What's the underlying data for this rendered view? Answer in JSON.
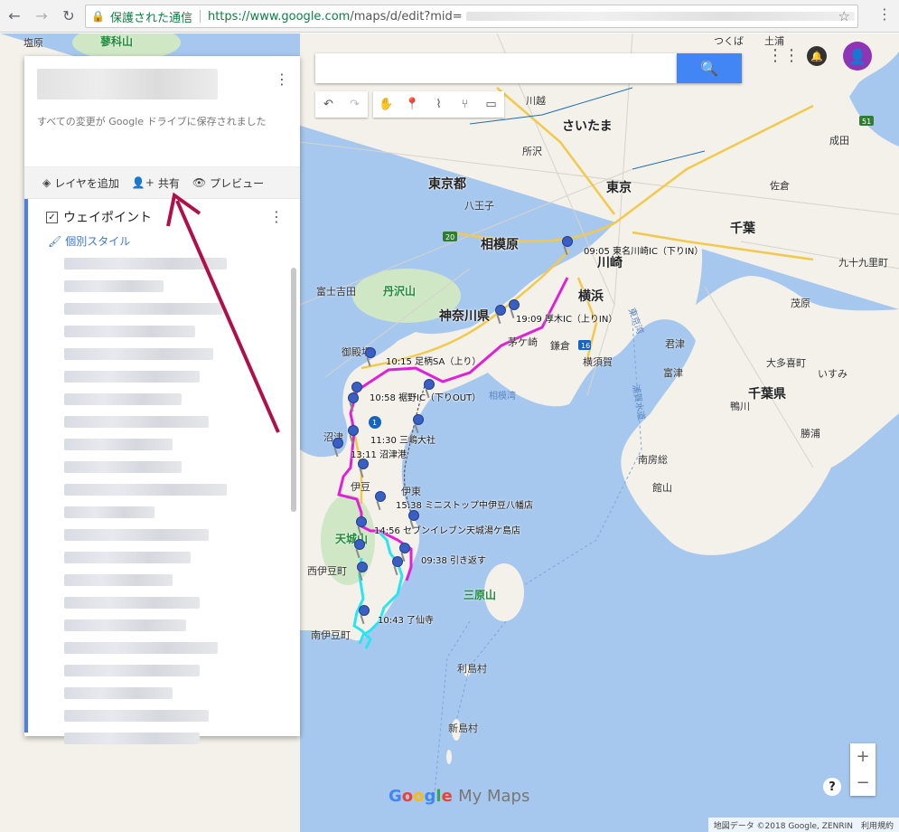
{
  "browser": {
    "secure_label": "保護された通信",
    "url_host": "https://www.google.com",
    "url_rest": "/maps/d/edit?mid="
  },
  "panel": {
    "saved_text": "すべての変更が Google ドライブに保存されました",
    "actions": {
      "add_layer": "レイヤを追加",
      "share": "共有",
      "preview": "プレビュー"
    },
    "layer": {
      "name": "ウェイポイント",
      "style_link": "個別スタイル"
    }
  },
  "search": {
    "placeholder": ""
  },
  "map_labels": {
    "cities": [
      {
        "id": "tokyo",
        "text": "東京都"
      },
      {
        "id": "saitama",
        "text": "さいたま"
      },
      {
        "id": "tokyo2",
        "text": "東京"
      },
      {
        "id": "sagamihara",
        "text": "相模原"
      },
      {
        "id": "kawasaki",
        "text": "川崎"
      },
      {
        "id": "yokohama",
        "text": "横浜"
      },
      {
        "id": "kanagawa",
        "text": "神奈川県"
      },
      {
        "id": "chiba",
        "text": "千葉"
      },
      {
        "id": "chibaken",
        "text": "千葉県"
      }
    ],
    "towns": [
      {
        "id": "shiobara",
        "text": "塩原"
      },
      {
        "id": "kawagoe",
        "text": "川越"
      },
      {
        "id": "tokorozawa",
        "text": "所沢"
      },
      {
        "id": "hachioji",
        "text": "八王子"
      },
      {
        "id": "kamakura",
        "text": "鎌倉"
      },
      {
        "id": "chigasaki",
        "text": "茅ケ崎"
      },
      {
        "id": "yokosuka",
        "text": "横須賀"
      },
      {
        "id": "kisarazu",
        "text": "君津"
      },
      {
        "id": "futtsu",
        "text": "富津"
      },
      {
        "id": "kamogawa",
        "text": "鴨川"
      },
      {
        "id": "tateyama",
        "text": "館山"
      },
      {
        "id": "minamiboso",
        "text": "南房総"
      },
      {
        "id": "katsuura",
        "text": "勝浦"
      },
      {
        "id": "mobara",
        "text": "茂原"
      },
      {
        "id": "ito",
        "text": "伊東"
      },
      {
        "id": "izu",
        "text": "伊豆"
      },
      {
        "id": "numazu",
        "text": "沼津"
      },
      {
        "id": "gotemba",
        "text": "御殿場"
      },
      {
        "id": "minamiizu",
        "text": "南伊豆町"
      },
      {
        "id": "nishiizu",
        "text": "西伊豆町"
      },
      {
        "id": "toshima",
        "text": "利島村"
      },
      {
        "id": "niijima",
        "text": "新島村"
      },
      {
        "id": "fujiyoshida",
        "text": "富士吉田"
      },
      {
        "id": "narita",
        "text": "成田"
      },
      {
        "id": "sakura",
        "text": "佐倉"
      },
      {
        "id": "kujukuri",
        "text": "九十九里町"
      },
      {
        "id": "isumi",
        "text": "いすみ"
      },
      {
        "id": "otaki",
        "text": "大多喜町"
      },
      {
        "id": "tsukuba",
        "text": "つくば"
      },
      {
        "id": "tsuchiura",
        "text": "土浦"
      }
    ],
    "mountains": [
      {
        "id": "tanzawa",
        "text": "丹沢山"
      },
      {
        "id": "amagi",
        "text": "天城山"
      },
      {
        "id": "miharayama",
        "text": "三原山"
      },
      {
        "id": "sanmoku",
        "text": "蓼科山"
      }
    ],
    "seas": [
      {
        "id": "sagamiwan",
        "text": "相模湾"
      },
      {
        "id": "uraga",
        "text": "浦賀水道"
      },
      {
        "id": "tokyowan",
        "text": "東京湾"
      }
    ],
    "waypoints": [
      {
        "id": "wp1",
        "text": "09:05 東名川崎IC（下りIN）"
      },
      {
        "id": "wp2",
        "text": "19:09 厚木IC（上りIN）"
      },
      {
        "id": "wp3",
        "text": "10:15 足柄SA（上り）"
      },
      {
        "id": "wp4",
        "text": "10:58 裾野IC（下りOUT）"
      },
      {
        "id": "wp5",
        "text": "11:30 三嶋大社"
      },
      {
        "id": "wp6",
        "text": "13:11 沼津港"
      },
      {
        "id": "wp7",
        "text": "15:38 ミニストップ中伊豆八幡店"
      },
      {
        "id": "wp8",
        "text": "14:56 セブンイレブン天城湯ケ島店"
      },
      {
        "id": "wp9",
        "text": "09:38 引き返す"
      },
      {
        "id": "wp10",
        "text": "10:43 了仙寺"
      }
    ]
  },
  "logo": {
    "google": "Google",
    "mymaps": "My Maps"
  },
  "attribution": "地図データ ©2018 Google, ZENRIN　利用規約",
  "colors": {
    "route_magenta": "#e020d8",
    "route_cyan": "#27e6f0",
    "pin": "#3a5fc4",
    "arrow": "#b0104a",
    "search_btn": "#4285f4"
  }
}
